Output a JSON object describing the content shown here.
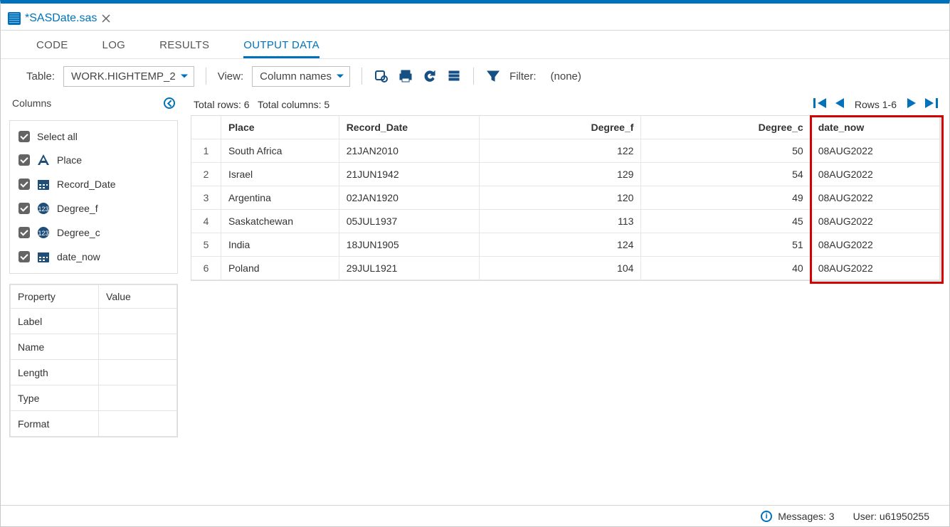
{
  "file": {
    "name": "*SASDate.sas"
  },
  "tabs": {
    "code": "CODE",
    "log": "LOG",
    "results": "RESULTS",
    "output": "OUTPUT DATA"
  },
  "toolbar": {
    "table_label": "Table:",
    "table_value": "WORK.HIGHTEMP_2",
    "view_label": "View:",
    "view_value": "Column names",
    "filter_label": "Filter:",
    "filter_value": "(none)"
  },
  "columns_panel": {
    "title": "Columns",
    "select_all": "Select all",
    "items": [
      {
        "name": "Place",
        "type": "char"
      },
      {
        "name": "Record_Date",
        "type": "date"
      },
      {
        "name": "Degree_f",
        "type": "num"
      },
      {
        "name": "Degree_c",
        "type": "num"
      },
      {
        "name": "date_now",
        "type": "date"
      }
    ]
  },
  "props": {
    "h1": "Property",
    "h2": "Value",
    "r": [
      "Label",
      "Name",
      "Length",
      "Type",
      "Format"
    ]
  },
  "grid": {
    "total_rows_label": "Total rows: 6",
    "total_cols_label": "Total columns: 5",
    "rows_label": "Rows 1-6",
    "headers": [
      "Place",
      "Record_Date",
      "Degree_f",
      "Degree_c",
      "date_now"
    ],
    "rows": [
      {
        "n": 1,
        "Place": "South Africa",
        "Record_Date": "21JAN2010",
        "Degree_f": "122",
        "Degree_c": "50",
        "date_now": "08AUG2022"
      },
      {
        "n": 2,
        "Place": "Israel",
        "Record_Date": "21JUN1942",
        "Degree_f": "129",
        "Degree_c": "54",
        "date_now": "08AUG2022"
      },
      {
        "n": 3,
        "Place": "Argentina",
        "Record_Date": "02JAN1920",
        "Degree_f": "120",
        "Degree_c": "49",
        "date_now": "08AUG2022"
      },
      {
        "n": 4,
        "Place": "Saskatchewan",
        "Record_Date": "05JUL1937",
        "Degree_f": "113",
        "Degree_c": "45",
        "date_now": "08AUG2022"
      },
      {
        "n": 5,
        "Place": "India",
        "Record_Date": "18JUN1905",
        "Degree_f": "124",
        "Degree_c": "51",
        "date_now": "08AUG2022"
      },
      {
        "n": 6,
        "Place": "Poland",
        "Record_Date": "29JUL1921",
        "Degree_f": "104",
        "Degree_c": "40",
        "date_now": "08AUG2022"
      }
    ]
  },
  "status": {
    "messages": "Messages: 3",
    "user": "User: u61950255"
  }
}
